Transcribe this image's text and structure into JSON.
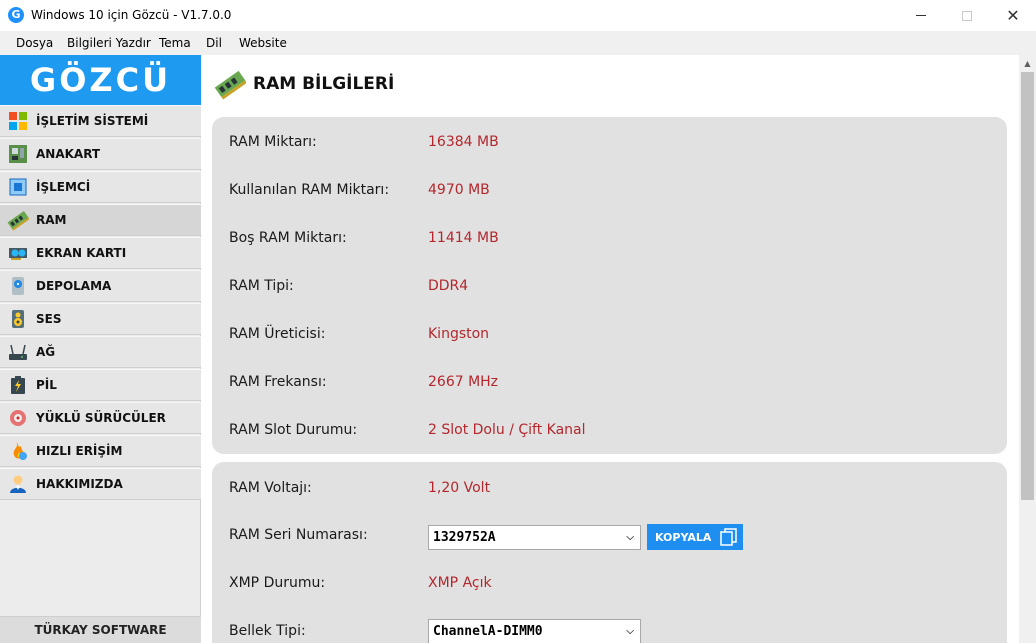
{
  "window": {
    "title": "Windows 10 için Gözcü - V1.7.0.0",
    "app_icon_letter": "G",
    "controls": {
      "close_glyph": "✕"
    }
  },
  "menu": [
    "Dosya",
    "Bilgileri Yazdır",
    "Tema",
    "Dil",
    "Website"
  ],
  "sidebar": {
    "logo": "GÖZCÜ",
    "items": [
      {
        "label": "İŞLETİM SİSTEMİ",
        "icon": "windows-icon"
      },
      {
        "label": "ANAKART",
        "icon": "motherboard-icon"
      },
      {
        "label": "İŞLEMCİ",
        "icon": "cpu-icon"
      },
      {
        "label": "RAM",
        "icon": "ram-icon"
      },
      {
        "label": "EKRAN KARTI",
        "icon": "gpu-icon"
      },
      {
        "label": "DEPOLAMA",
        "icon": "storage-icon"
      },
      {
        "label": "SES",
        "icon": "speaker-icon"
      },
      {
        "label": "AĞ",
        "icon": "router-icon"
      },
      {
        "label": "PİL",
        "icon": "battery-icon"
      },
      {
        "label": "YÜKLÜ SÜRÜCÜLER",
        "icon": "drivers-icon"
      },
      {
        "label": "HIZLI ERİŞİM",
        "icon": "flame-icon"
      },
      {
        "label": "HAKKIMIZDA",
        "icon": "user-icon"
      }
    ],
    "active_index": 3,
    "footer": "TÜRKAY SOFTWARE"
  },
  "main": {
    "title": "RAM BİLGİLERİ",
    "card1": [
      {
        "label": "RAM Miktarı:",
        "value": "16384 MB"
      },
      {
        "label": "Kullanılan RAM Miktarı:",
        "value": "4970 MB"
      },
      {
        "label": "Boş RAM Miktarı:",
        "value": "11414 MB"
      },
      {
        "label": "RAM Tipi:",
        "value": "DDR4"
      },
      {
        "label": "RAM Üreticisi:",
        "value": "Kingston"
      },
      {
        "label": "RAM Frekansı:",
        "value": "2667 MHz"
      },
      {
        "label": "RAM Slot Durumu:",
        "value": "2 Slot Dolu / Çift Kanal"
      }
    ],
    "card2": {
      "voltage": {
        "label": "RAM Voltajı:",
        "value": "1,20 Volt"
      },
      "serial": {
        "label": "RAM Seri Numarası:",
        "selected": "1329752A",
        "copy_label": "KOPYALA"
      },
      "xmp": {
        "label": "XMP Durumu:",
        "value": "XMP Açık"
      },
      "memtype": {
        "label": "Bellek Tipi:",
        "selected": "ChannelA-DIMM0"
      }
    }
  },
  "colors": {
    "accent": "#1e9bf0",
    "value_text": "#b3272d",
    "card_bg": "#e1e1e1"
  }
}
